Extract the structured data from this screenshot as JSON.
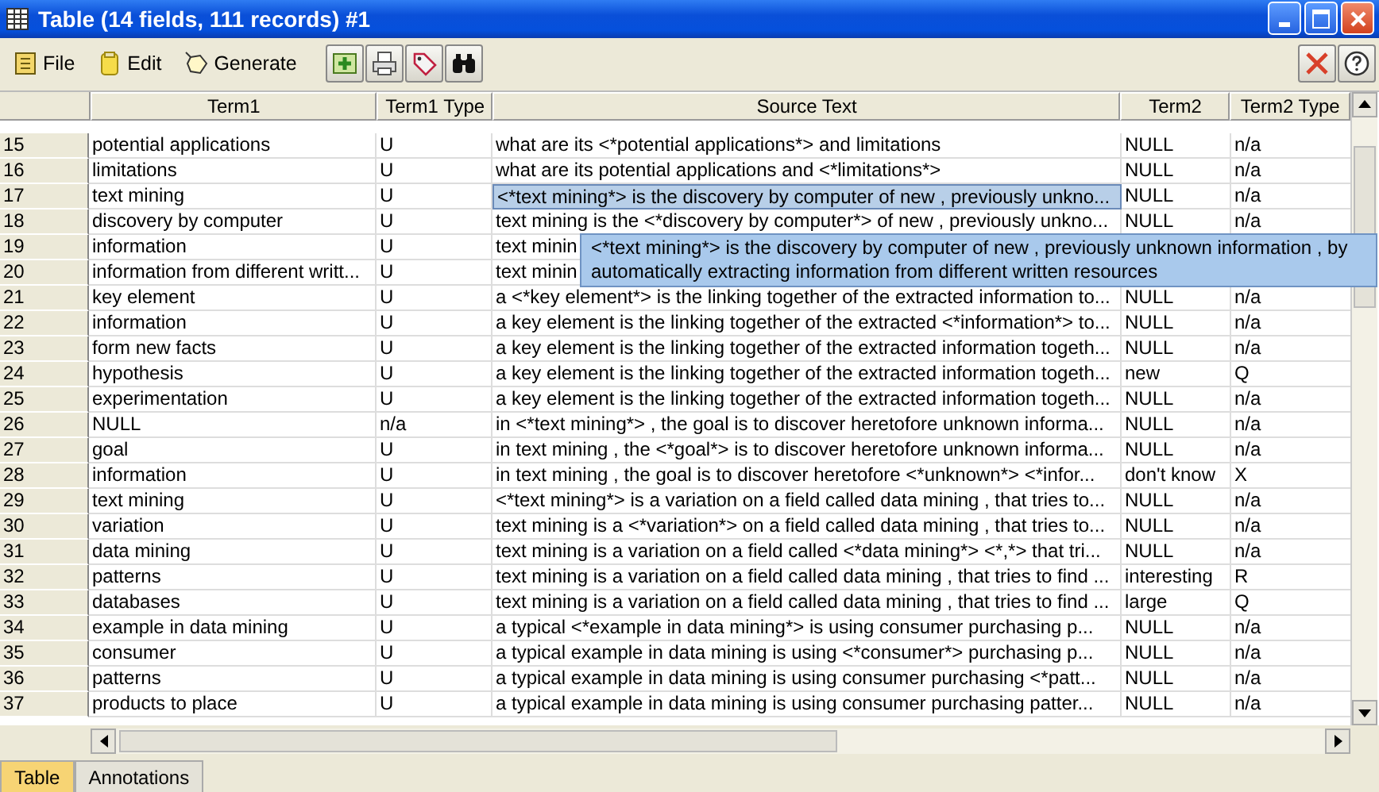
{
  "window": {
    "title": "Table (14 fields, 111 records) #1"
  },
  "menu": [
    {
      "label": "File"
    },
    {
      "label": "Edit"
    },
    {
      "label": "Generate"
    }
  ],
  "table": {
    "columns": [
      "Term1",
      "Term1 Type",
      "Source Text",
      "Term2",
      "Term2 Type"
    ],
    "rows": [
      {
        "n": "15",
        "cells": [
          "potential applications",
          "U",
          "what are its <*potential applications*> and limitations",
          "NULL",
          "n/a"
        ],
        "selected": false
      },
      {
        "n": "16",
        "cells": [
          "limitations",
          "U",
          "what are its potential applications and <*limitations*>",
          "NULL",
          "n/a"
        ],
        "selected": false
      },
      {
        "n": "17",
        "cells": [
          "text mining",
          "U",
          "<*text mining*> is the discovery by computer of new , previously unkno...",
          "NULL",
          "n/a"
        ],
        "selected": true
      },
      {
        "n": "18",
        "cells": [
          "discovery by computer",
          "U",
          "text mining is the <*discovery by computer*> of new , previously unkno...",
          "NULL",
          "n/a"
        ],
        "selected": false
      },
      {
        "n": "19",
        "cells": [
          "information",
          "U",
          "text minin"
        ],
        "selected": false
      },
      {
        "n": "20",
        "cells": [
          "information from different writt...",
          "U",
          "text minin"
        ],
        "selected": false
      },
      {
        "n": "21",
        "cells": [
          "key element",
          "U",
          "a <*key element*> is the linking together of the extracted information to...",
          "NULL",
          "n/a"
        ],
        "selected": false
      },
      {
        "n": "22",
        "cells": [
          "information",
          "U",
          "a key element is the linking together of the extracted <*information*> to...",
          "NULL",
          "n/a"
        ],
        "selected": false
      },
      {
        "n": "23",
        "cells": [
          "form new facts",
          "U",
          "a key element is the linking together of the extracted information togeth...",
          "NULL",
          "n/a"
        ],
        "selected": false
      },
      {
        "n": "24",
        "cells": [
          "hypothesis",
          "U",
          "a key element is the linking together of the extracted information togeth...",
          "new",
          "Q"
        ],
        "selected": false
      },
      {
        "n": "25",
        "cells": [
          "experimentation",
          "U",
          "a key element is the linking together of the extracted information togeth...",
          "NULL",
          "n/a"
        ],
        "selected": false
      },
      {
        "n": "26",
        "cells": [
          "NULL",
          "n/a",
          "in <*text mining*> , the goal is to discover heretofore unknown informa...",
          "NULL",
          "n/a"
        ],
        "selected": false
      },
      {
        "n": "27",
        "cells": [
          "goal",
          "U",
          "in text mining , the <*goal*> is to discover heretofore unknown informa...",
          "NULL",
          "n/a"
        ],
        "selected": false
      },
      {
        "n": "28",
        "cells": [
          "information",
          "U",
          "in text mining , the goal is to discover heretofore <*unknown*> <*infor...",
          "don't know",
          "X"
        ],
        "selected": false
      },
      {
        "n": "29",
        "cells": [
          "text mining",
          "U",
          "<*text mining*> is a variation on a field called data mining , that tries to...",
          "NULL",
          "n/a"
        ],
        "selected": false
      },
      {
        "n": "30",
        "cells": [
          "variation",
          "U",
          "text mining is a <*variation*> on a field called data mining , that tries to...",
          "NULL",
          "n/a"
        ],
        "selected": false
      },
      {
        "n": "31",
        "cells": [
          "data mining",
          "U",
          "text mining is a variation on a field called <*data mining*> <*,*> that tri...",
          "NULL",
          "n/a"
        ],
        "selected": false
      },
      {
        "n": "32",
        "cells": [
          "patterns",
          "U",
          "text mining is a variation on a field called data mining , that tries to find ...",
          "interesting",
          "R"
        ],
        "selected": false
      },
      {
        "n": "33",
        "cells": [
          "databases",
          "U",
          "text mining is a variation on a field called data mining , that tries to find ...",
          "large",
          "Q"
        ],
        "selected": false
      },
      {
        "n": "34",
        "cells": [
          "example in data mining",
          "U",
          "a typical <*example in data mining*> is using consumer purchasing p...",
          "NULL",
          "n/a"
        ],
        "selected": false
      },
      {
        "n": "35",
        "cells": [
          "consumer",
          "U",
          "a typical example in data mining is using <*consumer*> purchasing p...",
          "NULL",
          "n/a"
        ],
        "selected": false
      },
      {
        "n": "36",
        "cells": [
          "patterns",
          "U",
          "a typical example in data mining is using consumer purchasing <*patt...",
          "NULL",
          "n/a"
        ],
        "selected": false
      },
      {
        "n": "37",
        "cells": [
          "products to place",
          "U",
          "a typical example in data mining is using consumer purchasing patter...",
          "NULL",
          "n/a"
        ],
        "selected": false
      }
    ]
  },
  "tooltip": "<*text mining*> is the discovery by computer of new , previously unknown information , by automatically extracting information from different written resources",
  "tabs": [
    {
      "label": "Table",
      "selected": true
    },
    {
      "label": "Annotations",
      "selected": false
    }
  ]
}
